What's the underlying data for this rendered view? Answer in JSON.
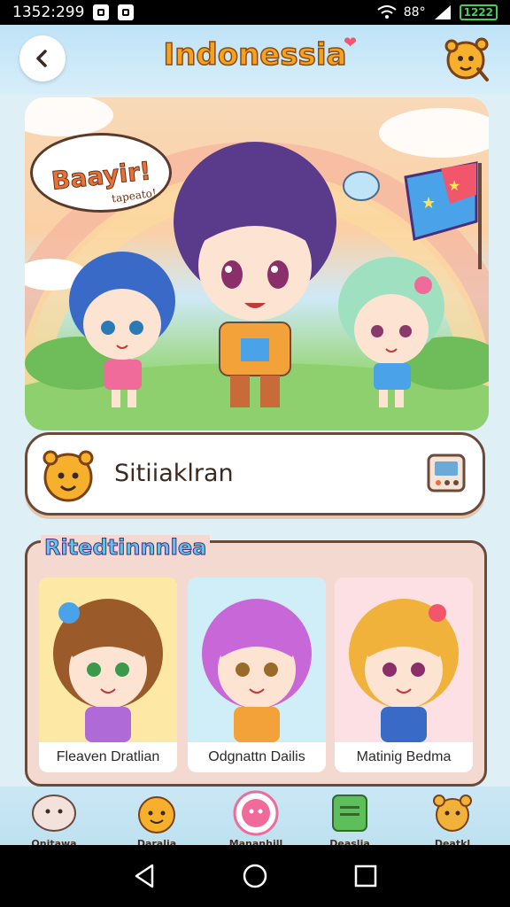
{
  "status_bar": {
    "time": "1352:299",
    "battery_label": "88°",
    "battery_value": "1222"
  },
  "header": {
    "title": "Indonessia",
    "back_icon": "chevron-left-icon",
    "mascot_icon": "mascot-face-icon"
  },
  "hero": {
    "speech_title": "Baayir!",
    "speech_sub": "tapeato!",
    "accent": "#f6a21c"
  },
  "search": {
    "text": "Sitiiaklran"
  },
  "characters": {
    "title": "Ritedtinnnlea",
    "items": [
      {
        "name": "Fleaven Dratlian",
        "hair": "#9a5a2a",
        "bg": "#fde8a6"
      },
      {
        "name": "Odgnattn Dailis",
        "hair": "#c868d8",
        "bg": "#cfeef8"
      },
      {
        "name": "Matinig Bedma",
        "hair": "#f0b23a",
        "bg": "#fde0e4"
      }
    ]
  },
  "bottom_nav": {
    "items": [
      {
        "label": "Onitawa",
        "icon": "ghost-icon",
        "color": "#f3e2dc"
      },
      {
        "label": "Daralia",
        "icon": "mascot-icon",
        "color": "#f7b02c"
      },
      {
        "label": "Mananhill",
        "icon": "pink-face-icon",
        "color": "#f06a9a"
      },
      {
        "label": "Deaslia",
        "icon": "book-icon",
        "color": "#5cbf5a"
      },
      {
        "label": "Deatkl",
        "icon": "bear-icon",
        "color": "#f2b23a"
      }
    ]
  }
}
